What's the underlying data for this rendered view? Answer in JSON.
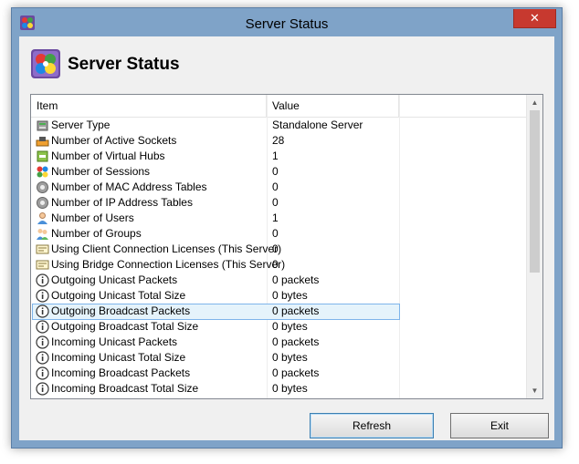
{
  "window": {
    "title": "Server Status",
    "close_glyph": "✕"
  },
  "header": {
    "heading": "Server Status",
    "icon": "server-manager-icon"
  },
  "list": {
    "columns": [
      "Item",
      "Value"
    ],
    "rows": [
      {
        "icon": "server-icon",
        "item": "Server Type",
        "value": "Standalone Server"
      },
      {
        "icon": "sockets-icon",
        "item": "Number of Active Sockets",
        "value": "28"
      },
      {
        "icon": "hub-icon",
        "item": "Number of Virtual Hubs",
        "value": "1"
      },
      {
        "icon": "sessions-icon",
        "item": "Number of Sessions",
        "value": "0"
      },
      {
        "icon": "gear-icon",
        "item": "Number of MAC Address Tables",
        "value": "0"
      },
      {
        "icon": "gear-icon",
        "item": "Number of IP Address Tables",
        "value": "0"
      },
      {
        "icon": "user-icon",
        "item": "Number of Users",
        "value": "1"
      },
      {
        "icon": "group-icon",
        "item": "Number of Groups",
        "value": "0"
      },
      {
        "icon": "license-icon",
        "item": "Using Client Connection Licenses (This Server)",
        "value": "0"
      },
      {
        "icon": "license-icon",
        "item": "Using Bridge Connection Licenses (This Server)",
        "value": "0"
      },
      {
        "icon": "info-icon",
        "item": "Outgoing Unicast Packets",
        "value": "0 packets"
      },
      {
        "icon": "info-icon",
        "item": "Outgoing Unicast Total Size",
        "value": "0 bytes"
      },
      {
        "icon": "info-icon",
        "item": "Outgoing Broadcast Packets",
        "value": "0 packets",
        "selected": true
      },
      {
        "icon": "info-icon",
        "item": "Outgoing Broadcast Total Size",
        "value": "0 bytes"
      },
      {
        "icon": "info-icon",
        "item": "Incoming Unicast Packets",
        "value": "0 packets"
      },
      {
        "icon": "info-icon",
        "item": "Incoming Unicast Total Size",
        "value": "0 bytes"
      },
      {
        "icon": "info-icon",
        "item": "Incoming Broadcast Packets",
        "value": "0 packets"
      },
      {
        "icon": "info-icon",
        "item": "Incoming Broadcast Total Size",
        "value": "0 bytes"
      }
    ]
  },
  "buttons": {
    "refresh": "Refresh",
    "exit": "Exit"
  },
  "colors": {
    "accent": "#3c7fb1",
    "selection": "#e5f3fb",
    "close": "#c7392f"
  }
}
